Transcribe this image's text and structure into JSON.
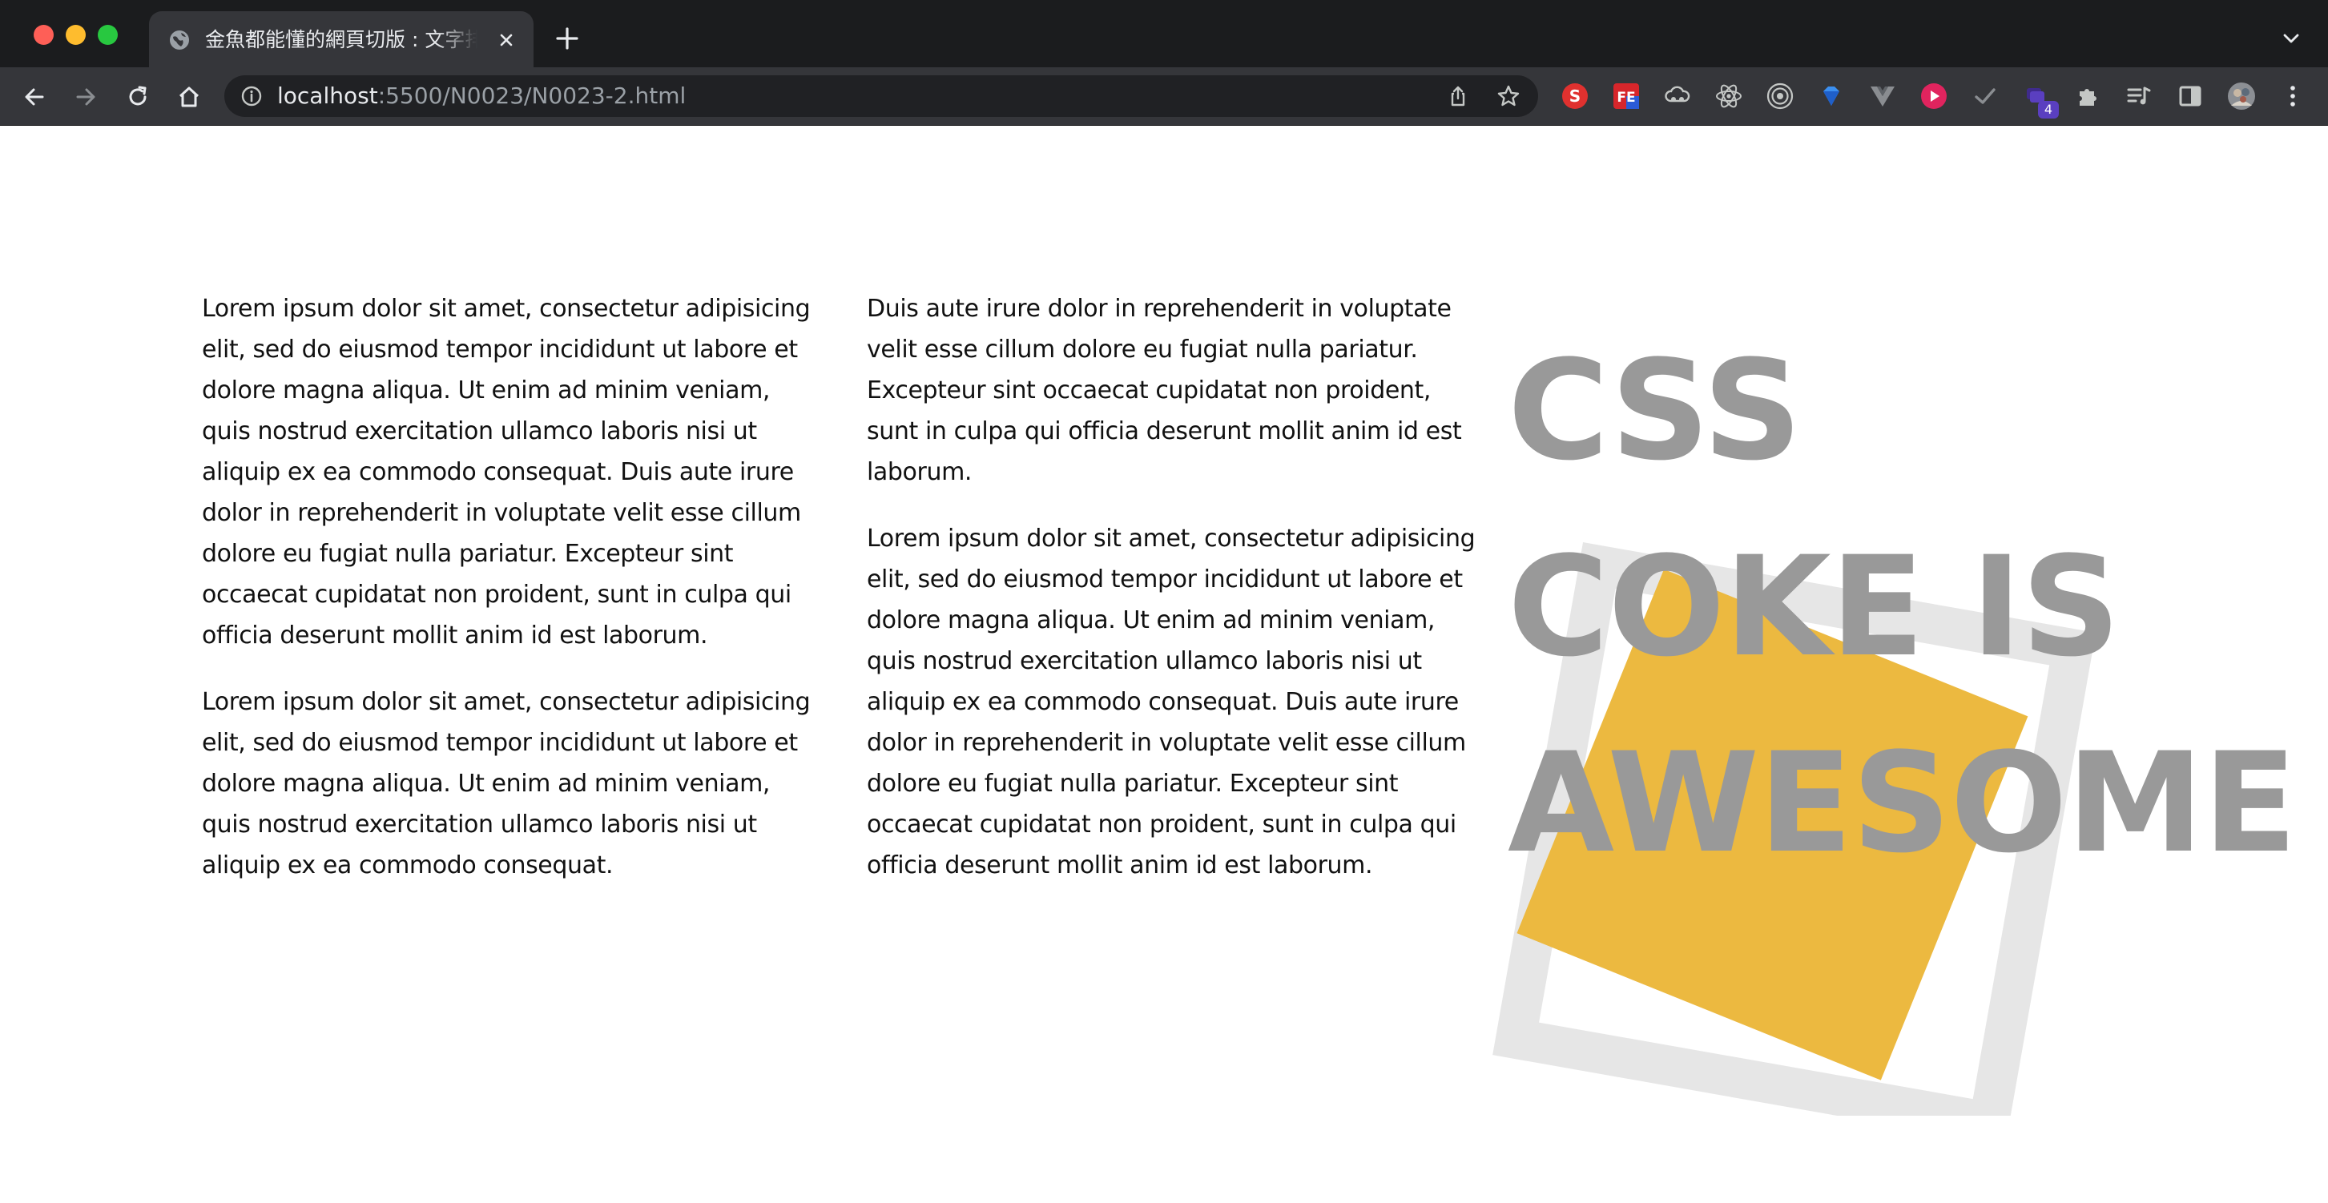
{
  "browser": {
    "tab_title": "金魚都能懂的網頁切版 : 文字排版",
    "url_host": "localhost",
    "url_path": ":5500/N0023/N0023-2.html",
    "extension_badge": "4"
  },
  "article": {
    "left_paragraphs": [
      "Lorem ipsum dolor sit amet, consectetur adipisicing elit, sed do eiusmod tempor incididunt ut labore et dolore magna aliqua. Ut enim ad minim veniam, quis nostrud exercitation ullamco laboris nisi ut aliquip ex ea commodo consequat. Duis aute irure dolor in reprehenderit in voluptate velit esse cillum dolore eu fugiat nulla pariatur. Excepteur sint occaecat cupidatat non proident, sunt in culpa qui officia deserunt mollit anim id est laborum.",
      "Lorem ipsum dolor sit amet, consectetur adipisicing elit, sed do eiusmod tempor incididunt ut labore et dolore magna aliqua. Ut enim ad minim veniam, quis nostrud exercitation ullamco laboris nisi ut aliquip ex ea commodo consequat."
    ],
    "right_paragraphs": [
      "Duis aute irure dolor in reprehenderit in voluptate velit esse cillum dolore eu fugiat nulla pariatur. Excepteur sint occaecat cupidatat non proident, sunt in culpa qui officia deserunt mollit anim id est laborum.",
      "Lorem ipsum dolor sit amet, consectetur adipisicing elit, sed do eiusmod tempor incididunt ut labore et dolore magna aliqua. Ut enim ad minim veniam, quis nostrud exercitation ullamco laboris nisi ut aliquip ex ea commodo consequat. Duis aute irure dolor in reprehenderit in voluptate velit esse cillum dolore eu fugiat nulla pariatur. Excepteur sint occaecat cupidatat non proident, sunt in culpa qui officia deserunt mollit anim id est laborum."
    ]
  },
  "headline": {
    "line1": "CSS",
    "line2": "COKE IS",
    "line3": "AWESOME"
  },
  "colors": {
    "headline_gray": "#999999",
    "frame_gray": "#e6e6e6",
    "accent_yellow": "#ecb940",
    "chrome_dark": "#202124"
  },
  "icons": {
    "back": "arrow-left-icon",
    "forward": "arrow-right-icon",
    "reload": "reload-icon",
    "home": "home-icon",
    "info": "info-icon",
    "share": "share-icon",
    "bookmark": "star-icon",
    "extensions": "puzzle-icon",
    "reading_list": "reading-list-icon",
    "side_panel": "side-panel-icon",
    "menu": "kebab-menu-icon"
  }
}
